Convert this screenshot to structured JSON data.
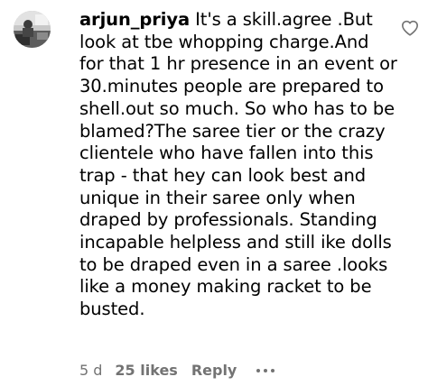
{
  "comment": {
    "username": "arjun_priya",
    "text": "It's a skill.agree .But look at tbe whopping charge.And for that 1 hr presence in an event or 30.minutes people are prepared to shell.out so much. So who has to be blamed?The saree tier or the crazy clientele who have fallen into this trap - that hey can look best and unique in their saree only when draped by professionals. Standing incapable helpless and still ike dolls to be draped even in a saree .looks like a money making racket to be busted.",
    "time": "5 d",
    "likes": "25 likes",
    "reply_label": "Reply"
  },
  "icons": {
    "avatar": "avatar",
    "like": "heart-outline-icon",
    "more": "more-options-icon"
  },
  "colors": {
    "text": "#000000",
    "meta": "#737373",
    "background": "#ffffff"
  }
}
